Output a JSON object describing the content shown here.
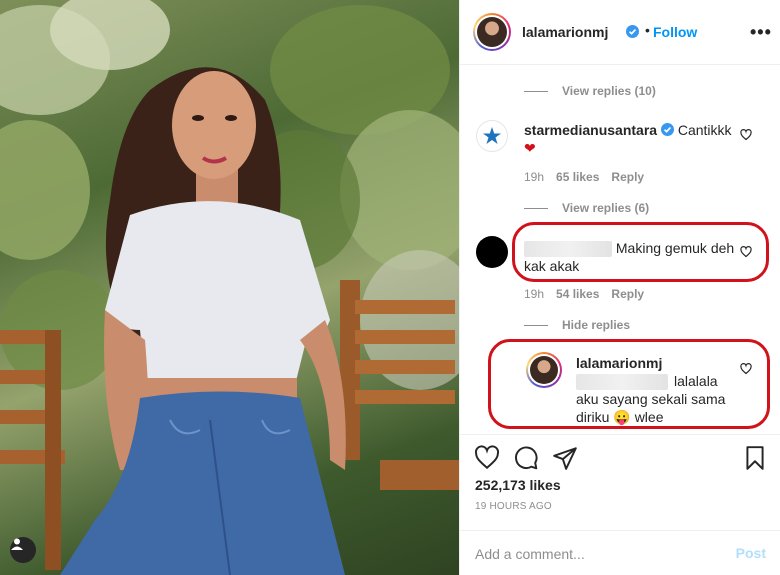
{
  "post": {
    "username": "lalamarionmj",
    "follow_label": "Follow",
    "dot": "•",
    "more_label": "•••"
  },
  "comments": {
    "view_replies_1": "View replies (10)",
    "c1": {
      "username": "starmedianusantara",
      "text": "Cantikkk",
      "emoji": "❤",
      "time": "19h",
      "likes": "65 likes",
      "reply": "Reply"
    },
    "view_replies_2": "View replies (6)",
    "c2": {
      "text": "Making gemuk deh kak akak",
      "time": "19h",
      "likes": "54 likes",
      "reply": "Reply"
    },
    "hide_replies": "Hide replies",
    "c3": {
      "username": "lalamarionmj",
      "text": "lalalala aku sayang sekali sama diriku",
      "emoji": "😛",
      "text_end": "wlee"
    }
  },
  "actions": {
    "likes": "252,173 likes",
    "time_ago": "19 HOURS AGO",
    "comment_placeholder": "Add a comment...",
    "post_label": "Post"
  },
  "colors": {
    "accent": "#0095f6",
    "highlight_box": "#d1121b",
    "muted": "#8e8e8e"
  },
  "icons": [
    "verified-icon",
    "heart-icon",
    "comment-icon",
    "share-icon",
    "bookmark-icon",
    "user-tag-icon",
    "more-options-icon"
  ]
}
